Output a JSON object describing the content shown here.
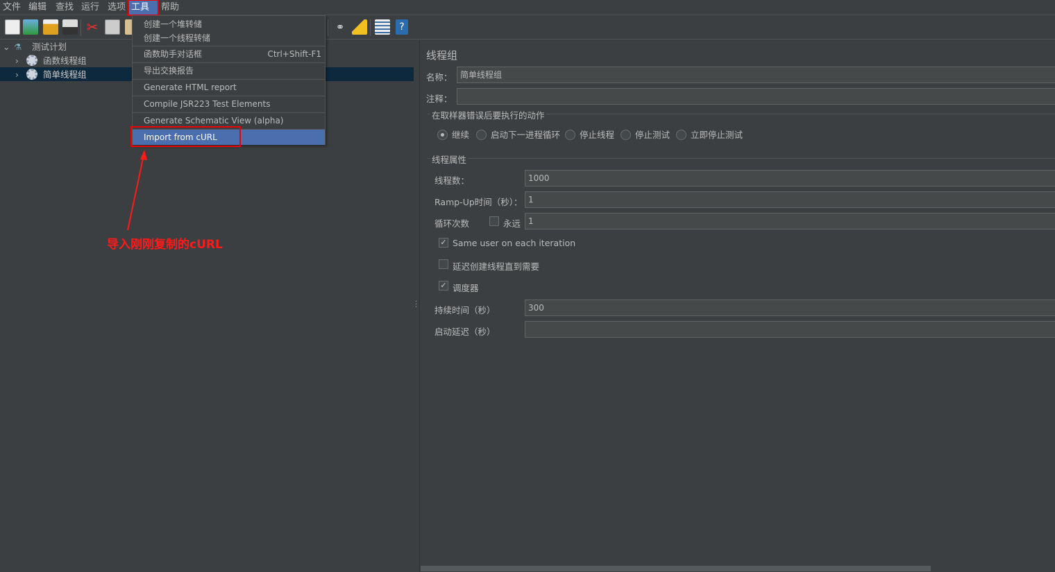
{
  "menubar": [
    "文件",
    "编辑",
    "查找",
    "运行",
    "选项",
    "工具",
    "帮助"
  ],
  "toolbar_icons": [
    "new-icon",
    "templates-icon",
    "open-icon",
    "save-icon",
    "cut-icon",
    "copy-icon",
    "paste-icon",
    "search-icon",
    "clear-all-icon",
    "function-helper-icon",
    "help-icon"
  ],
  "tree": {
    "root": "测试计划",
    "children": [
      "函数线程组",
      "简单线程组"
    ],
    "selected": "简单线程组"
  },
  "tools_menu": {
    "items": [
      {
        "label": "创建一个堆转储"
      },
      {
        "label": "创建一个线程转储"
      },
      {
        "label": "函数助手对话框",
        "shortcut": "Ctrl+Shift-F1"
      },
      {
        "label": "导出交换报告"
      },
      {
        "label": "Generate HTML report"
      },
      {
        "label": "Compile JSR223 Test Elements"
      },
      {
        "label": "Generate Schematic View (alpha)"
      },
      {
        "label": "Import from cURL"
      }
    ],
    "highlighted": "Import from cURL"
  },
  "annotation": {
    "text": "导入刚刚复制的cURL",
    "color": "#ff1a1a"
  },
  "panel": {
    "title": "线程组",
    "name_label": "名称：",
    "name_value": "简单线程组",
    "comment_label": "注释：",
    "comment_value": "",
    "error_action": {
      "title": "在取样器错误后要执行的动作",
      "options": [
        "继续",
        "启动下一进程循环",
        "停止线程",
        "停止测试",
        "立即停止测试"
      ],
      "selected": "继续"
    },
    "thread_props": {
      "title": "线程属性",
      "threads_label": "线程数：",
      "threads_value": "1000",
      "rampup_label": "Ramp-Up时间（秒）：",
      "rampup_value": "1",
      "loop_label": "循环次数",
      "forever_label": "永远",
      "forever_checked": false,
      "loop_value": "1",
      "same_user_label": "Same user on each iteration",
      "same_user_checked": true,
      "delay_label": "延迟创建线程直到需要",
      "delay_checked": false,
      "scheduler_label": "调度器",
      "scheduler_checked": true,
      "duration_label": "持续时间（秒）",
      "duration_value": "300",
      "startup_label": "启动延迟（秒）",
      "startup_value": ""
    }
  },
  "colors": {
    "background": "#3c3f41",
    "menu_highlight": "#4b6eaf",
    "tree_selection": "#0d293e",
    "annotation": "#ff1a1a"
  }
}
